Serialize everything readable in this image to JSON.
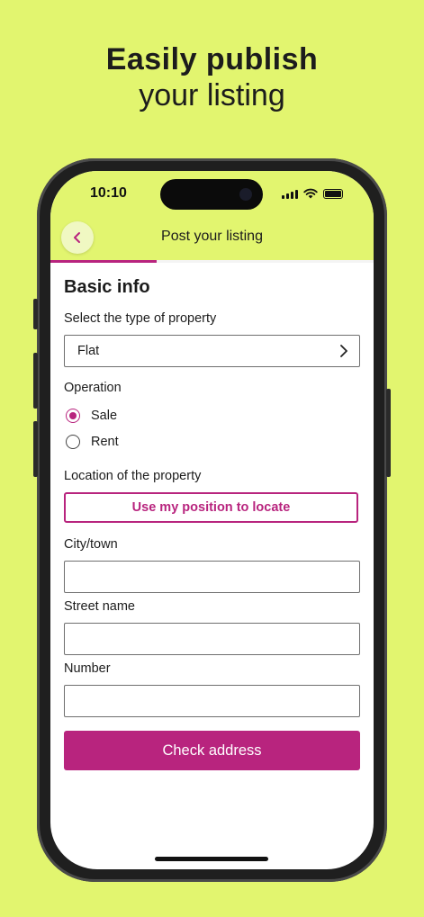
{
  "promo": {
    "line1": "Easily publish",
    "line2": "your listing"
  },
  "status_bar": {
    "time": "10:10",
    "icons": [
      "signal-icon",
      "wifi-icon",
      "battery-icon"
    ]
  },
  "header": {
    "title": "Post your listing",
    "back_icon": "chevron-left-icon",
    "progress": 0.33
  },
  "form": {
    "section_title": "Basic info",
    "property_type": {
      "label": "Select the type of property",
      "value": "Flat"
    },
    "operation": {
      "label": "Operation",
      "options": [
        {
          "label": "Sale",
          "selected": true
        },
        {
          "label": "Rent",
          "selected": false
        }
      ]
    },
    "location": {
      "label": "Location of the property",
      "button_label": "Use my position to locate"
    },
    "city": {
      "label": "City/town",
      "value": "",
      "placeholder": ""
    },
    "street": {
      "label": "Street name",
      "value": "",
      "placeholder": ""
    },
    "number": {
      "label": "Number",
      "value": "",
      "placeholder": ""
    },
    "submit_label": "Check address"
  },
  "colors": {
    "background": "#e2f56f",
    "accent": "#b8247e"
  }
}
